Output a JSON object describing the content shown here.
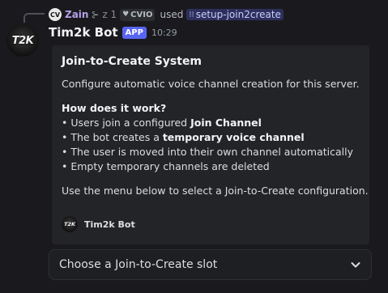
{
  "reply": {
    "avatar_text": "CV",
    "user_name": "Zain",
    "user_extra": "⊱ z 1",
    "tag_label": "CVIO",
    "used_text": "used",
    "command": "setup-join2create"
  },
  "message": {
    "avatar_text": "T2K",
    "bot_name": "Tim2k Bot",
    "badge": "APP",
    "timestamp": "10:29"
  },
  "embed": {
    "title": "Join-to-Create System",
    "intro": "Configure automatic voice channel creation for this server.",
    "how_heading": "How does it work?",
    "bullet1_pre": "• Users join a configured ",
    "bullet1_bold": "Join Channel",
    "bullet2_pre": "• The bot creates a ",
    "bullet2_bold": "temporary voice channel",
    "bullet3": "• The user is moved into their own channel automatically",
    "bullet4": "• Empty temporary channels are deleted",
    "outro": "Use the menu below to select a Join-to-Create configuration.",
    "footer_icon_text": "T2K",
    "footer_text": "Tim2k Bot"
  },
  "select_menu": {
    "placeholder": "Choose a Join-to-Create slot",
    "icon": "chevron-down-icon"
  },
  "colors": {
    "background": "#1a1a1e",
    "embed_bg": "#232428",
    "app_badge": "#5865f2",
    "command_link": "#c9cdfb",
    "reply_name": "#b5a2e8"
  }
}
